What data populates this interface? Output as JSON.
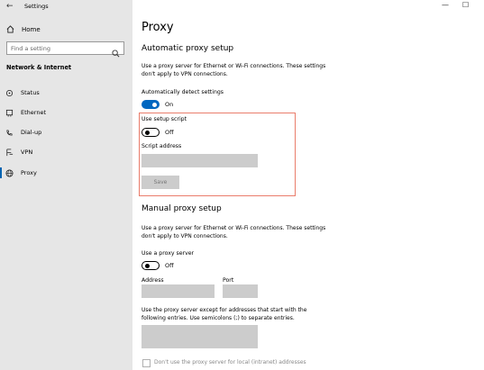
{
  "window": {
    "title": "Settings",
    "back": "←",
    "minimize": "—",
    "maximize": "☐"
  },
  "sidebar": {
    "home": "Home",
    "search_placeholder": "Find a setting",
    "section": "Network & Internet",
    "items": [
      {
        "label": "Status",
        "icon": "status-icon"
      },
      {
        "label": "Ethernet",
        "icon": "ethernet-icon"
      },
      {
        "label": "Dial-up",
        "icon": "dialup-icon"
      },
      {
        "label": "VPN",
        "icon": "vpn-icon"
      },
      {
        "label": "Proxy",
        "icon": "globe-icon",
        "active": true
      }
    ]
  },
  "main": {
    "title": "Proxy",
    "auto": {
      "heading": "Automatic proxy setup",
      "desc": "Use a proxy server for Ethernet or Wi-Fi connections. These settings don't apply to VPN connections.",
      "detect_label": "Automatically detect settings",
      "detect_state": "On",
      "script_label": "Use setup script",
      "script_state": "Off",
      "address_label": "Script address",
      "address_value": "",
      "save": "Save"
    },
    "manual": {
      "heading": "Manual proxy setup",
      "desc": "Use a proxy server for Ethernet or Wi-Fi connections. These settings don't apply to VPN connections.",
      "use_label": "Use a proxy server",
      "use_state": "Off",
      "address_label": "Address",
      "port_label": "Port",
      "address_value": "",
      "port_value": "",
      "except_desc": "Use the proxy server except for addresses that start with the following entries. Use semicolons (;) to separate entries.",
      "except_value": "",
      "local_label": "Don't use the proxy server for local (intranet) addresses"
    }
  },
  "colors": {
    "accent": "#0067c0",
    "highlight": "#ea7d6b",
    "sidebar_bg": "#e6e6e6"
  }
}
